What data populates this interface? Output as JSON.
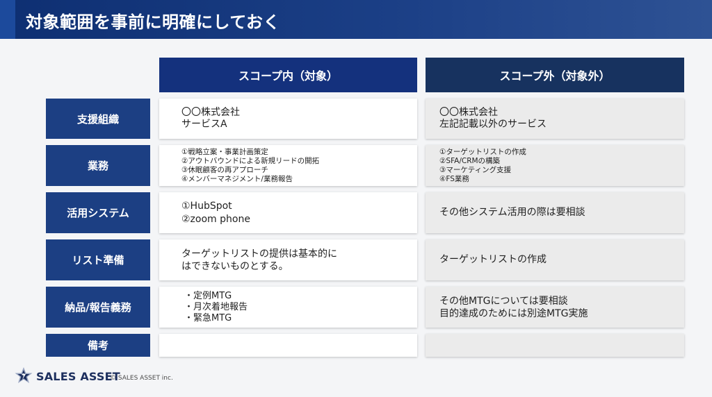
{
  "header": {
    "title": "対象範囲を事前に明確にしておく"
  },
  "columns": {
    "in": "スコープ内（対象）",
    "out": "スコープ外（対象外）"
  },
  "rows": [
    {
      "label": "支援組織",
      "in": [
        "〇〇株式会社",
        "サービスA"
      ],
      "out": [
        "〇〇株式会社",
        "左記記載以外のサービス"
      ]
    },
    {
      "label": "業務",
      "in": [
        "①戦略立案・事業計画策定",
        "②アウトバウンドによる新規リードの開拓",
        "③休眠顧客の再アプローチ",
        "④メンバーマネジメント/業務報告"
      ],
      "out": [
        "①ターゲットリストの作成",
        "②SFA/CRMの構築",
        "③マーケティング支援",
        "④FS業務"
      ]
    },
    {
      "label": "活用システム",
      "in": [
        "①HubSpot",
        "②zoom phone"
      ],
      "out": [
        "その他システム活用の際は要相談"
      ]
    },
    {
      "label": "リスト準備",
      "in": [
        "ターゲットリストの提供は基本的に",
        "はできないものとする。"
      ],
      "out": [
        "ターゲットリストの作成"
      ]
    },
    {
      "label": "納品/報告義務",
      "in": [
        "・定例MTG",
        "・月次着地報告",
        "・緊急MTG"
      ],
      "out": [
        "その他MTGについては要相談",
        "目的達成のためには別途MTG実施"
      ]
    },
    {
      "label": "備考",
      "in": [],
      "out": []
    }
  ],
  "footer": {
    "brand": "SALES ASSET",
    "copyright": "© SALES ASSET inc.",
    "logo_icon": "star-logo-icon"
  }
}
